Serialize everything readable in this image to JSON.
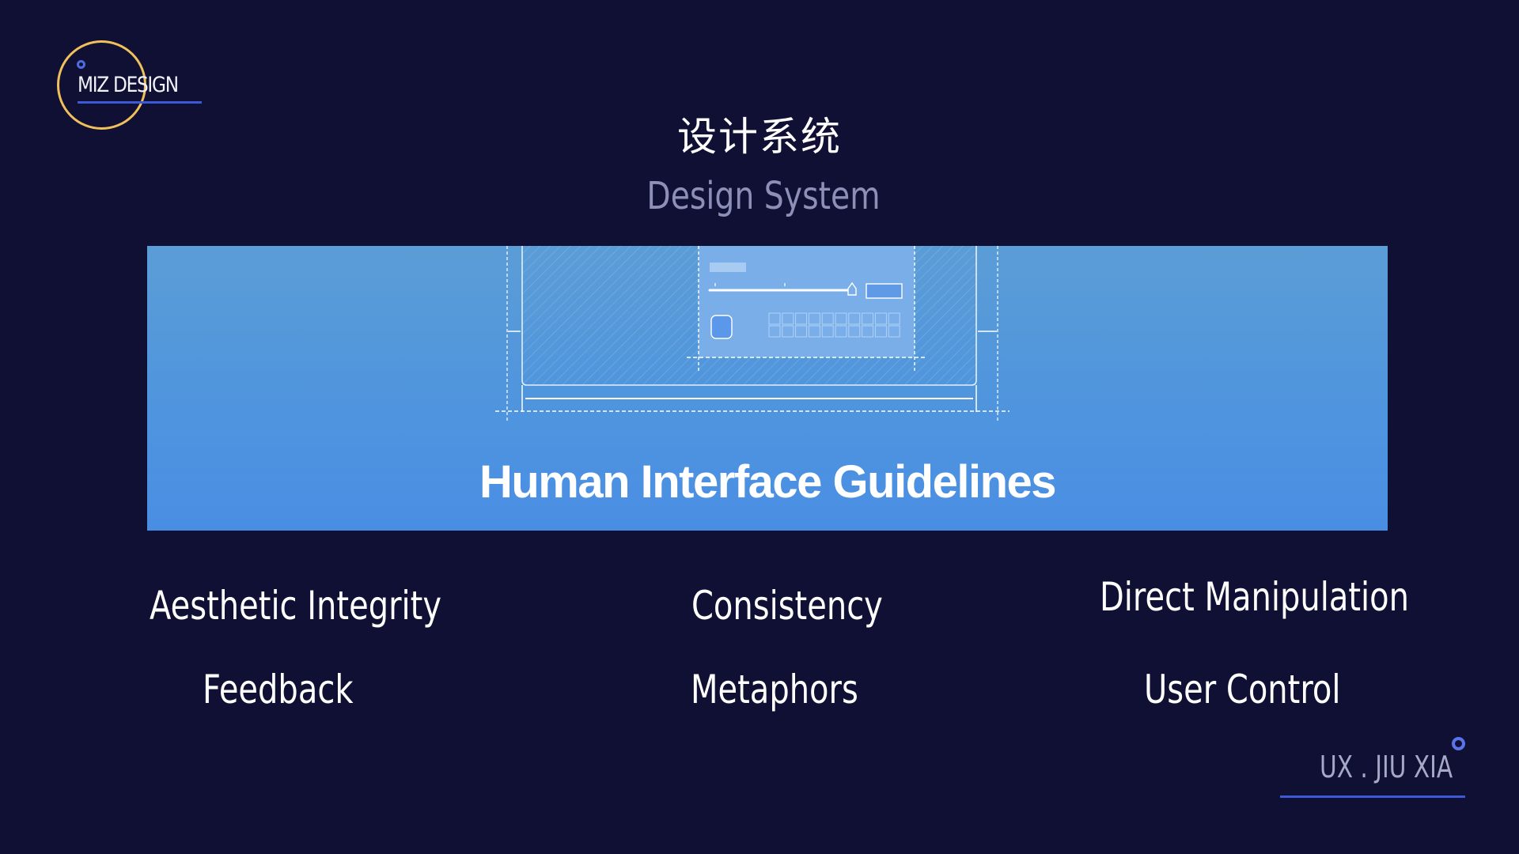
{
  "logo": {
    "text": "MIZ DESIGN",
    "ring_color": "#f0c05a",
    "accent_color": "#3e59d8"
  },
  "header": {
    "title_cn": "设计系统",
    "title_en": "Design System"
  },
  "banner": {
    "title": "Human Interface Guidelines",
    "illustration": "device-layout-wireframe"
  },
  "principles": [
    {
      "label": "Aesthetic Integrity"
    },
    {
      "label": "Consistency"
    },
    {
      "label": "Direct Manipulation"
    },
    {
      "label": "Feedback"
    },
    {
      "label": "Metaphors"
    },
    {
      "label": "User Control"
    }
  ],
  "footer": {
    "text": "UX . JIU XIA"
  },
  "colors": {
    "background": "#0f1033",
    "banner_top": "#5b9dd6",
    "banner_bottom": "#4a8ee4",
    "subtitle": "#8e8fb8"
  }
}
